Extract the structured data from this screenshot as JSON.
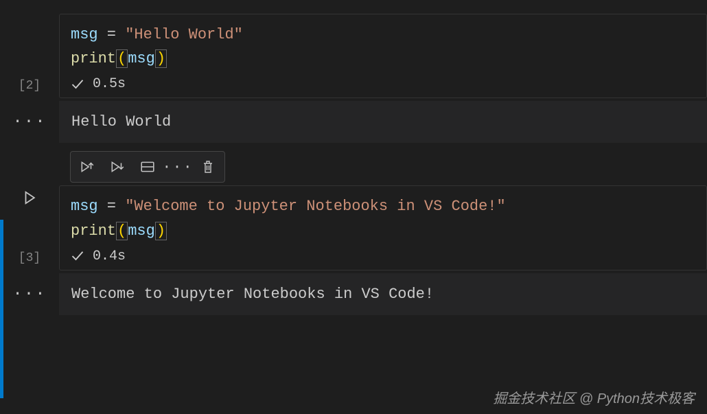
{
  "cells": [
    {
      "exec_count": "[2]",
      "var_name": "msg",
      "assign_op": " = ",
      "str_quote_l": "\"",
      "str_content": "Hello World",
      "str_quote_r": "\"",
      "print_fn": "print",
      "lparen": "(",
      "arg": "msg",
      "rparen": ")",
      "duration": "0.5s",
      "output": "Hello World"
    },
    {
      "exec_count": "[3]",
      "var_name": "msg",
      "assign_op": " = ",
      "str_quote_l": "\"",
      "str_content": "Welcome to Jupyter Notebooks in VS Code!",
      "str_quote_r": "\"",
      "print_fn": "print",
      "lparen": "(",
      "arg": "msg",
      "rparen": ")",
      "duration": "0.4s",
      "output": "Welcome to Jupyter Notebooks in VS Code!"
    }
  ],
  "toolbar": {
    "run_above": "run-above",
    "run_below": "run-below",
    "split": "split-cell",
    "more": "···",
    "delete": "delete"
  },
  "gutter_more": "···",
  "watermark": "掘金技术社区 @ Python技术极客"
}
